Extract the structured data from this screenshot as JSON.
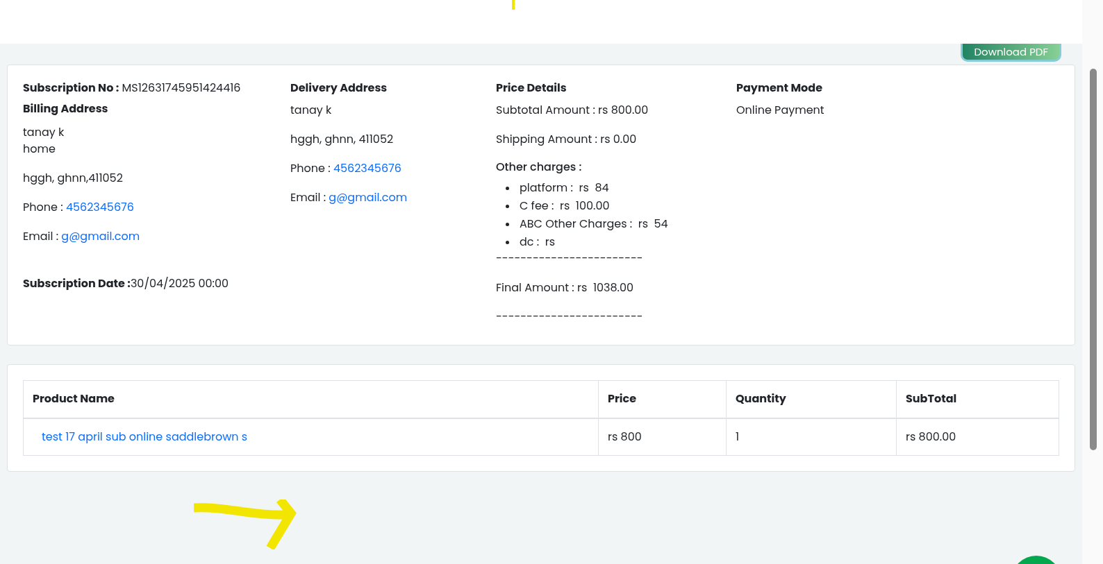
{
  "download_button": {
    "label": "Download PDF"
  },
  "subscription": {
    "label": "Subscription No :",
    "value": "MS12631745951424416"
  },
  "billing": {
    "title": "Billing Address",
    "name": "tanay k",
    "line2": "home",
    "address": "hggh, ghnn,411052",
    "phone_label": "Phone :",
    "phone": "4562345676",
    "email_label": "Email :",
    "email": "g@gmail.com"
  },
  "subscription_date": {
    "label": "Subscription Date :",
    "value": "30/04/2025 00:00"
  },
  "delivery": {
    "title": "Delivery Address",
    "name": "tanay k",
    "address": "hggh, ghnn, 411052",
    "phone_label": "Phone :",
    "phone": "4562345676",
    "email_label": "Email :",
    "email": "g@gmail.com"
  },
  "price": {
    "title": "Price Details",
    "lines": [
      "Subtotal Amount : rs 800.00",
      "Shipping Amount : rs 0.00"
    ],
    "other_title": "Other charges :",
    "other_charges": [
      "platform :  rs  84",
      "C fee :  rs  100.00",
      "ABC Other Charges :  rs  54",
      "dc :  rs"
    ],
    "divider": "------------------------",
    "final": "Final Amount : rs  1038.00",
    "divider_2": "------------------------"
  },
  "payment": {
    "title": "Payment Mode",
    "value": "Online Payment"
  },
  "table": {
    "columns": [
      "Product Name",
      "Price",
      "Quantity",
      "SubTotal"
    ],
    "rows": [
      {
        "cells": [
          "test 17 april sub online saddlebrown s",
          "rs 800",
          "1",
          "rs 800.00"
        ]
      }
    ]
  }
}
